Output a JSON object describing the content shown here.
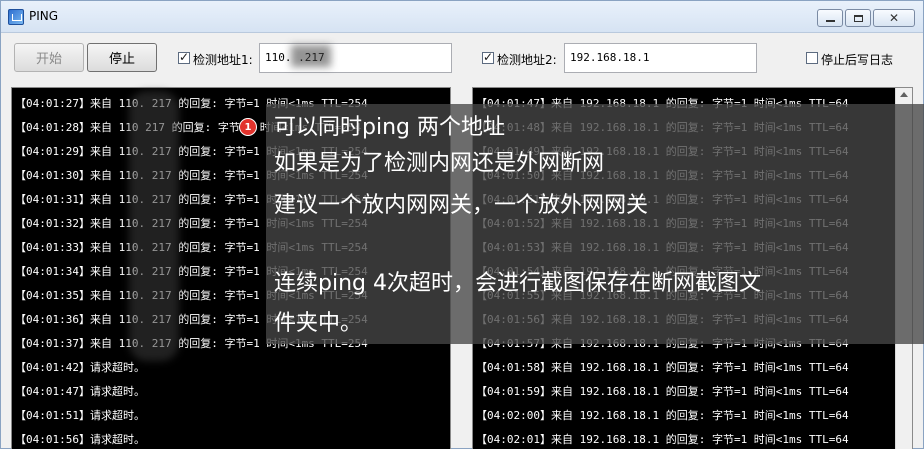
{
  "window": {
    "title": "PING"
  },
  "toolbar": {
    "start_label": "开始",
    "stop_label": "停止",
    "addr1_label": "检测地址1:",
    "addr1_value": "110.          .217",
    "addr2_label": "检测地址2:",
    "addr2_value": "192.168.18.1",
    "stoplog_label": "停止后写日志"
  },
  "left_log": [
    "【04:01:27】来自 110.          217 的回复: 字节=1 时间<1ms TTL=254",
    "【04:01:28】来自 110          217 的回复: 字节=1 时间<1ms TTL=254",
    "【04:01:29】来自 110.          217 的回复: 字节=1 时间<1ms TTL=254",
    "【04:01:30】来自 110.          217 的回复: 字节=1 时间<1ms TTL=254",
    "【04:01:31】来自 110.          217 的回复: 字节=1 时间<1ms TTL=254",
    "【04:01:32】来自 110.          217 的回复: 字节=1 时间<1ms TTL=254",
    "【04:01:33】来自 110.          217 的回复: 字节=1 时间<1ms TTL=254",
    "【04:01:34】来自 110.          217 的回复: 字节=1 时间<1ms TTL=254",
    "【04:01:35】来自 110.          217 的回复: 字节=1 时间<1ms TTL=254",
    "【04:01:36】来自 110.          217 的回复: 字节=1 时间<1ms TTL=254",
    "【04:01:37】来自 110.          217 的回复: 字节=1 时间<1ms TTL=254",
    "【04:01:42】请求超时。",
    "【04:01:47】请求超时。",
    "【04:01:51】请求超时。",
    "【04:01:56】请求超时。"
  ],
  "right_log": [
    "【04:01:47】来自 192.168.18.1 的回复: 字节=1 时间<1ms TTL=64",
    "【04:01:48】来自 192.168.18.1 的回复: 字节=1 时间<1ms TTL=64",
    "【04:01:49】来自 192.168.18.1 的回复: 字节=1 时间<1ms TTL=64",
    "【04:01:50】来自 192.168.18.1 的回复: 字节=1 时间<1ms TTL=64",
    "【04:01:51】来自 192.168.18.1 的回复: 字节=1 时间<1ms TTL=64",
    "【04:01:52】来自 192.168.18.1 的回复: 字节=1 时间<1ms TTL=64",
    "【04:01:53】来自 192.168.18.1 的回复: 字节=1 时间<1ms TTL=64",
    "【04:01:54】来自 192.168.18.1 的回复: 字节=1 时间<1ms TTL=64",
    "【04:01:55】来自 192.168.18.1 的回复: 字节=1 时间<1ms TTL=64",
    "【04:01:56】来自 192.168.18.1 的回复: 字节=1 时间<1ms TTL=64",
    "【04:01:57】来自 192.168.18.1 的回复: 字节=1 时间<1ms TTL=64",
    "【04:01:58】来自 192.168.18.1 的回复: 字节=1 时间<1ms TTL=64",
    "【04:01:59】来自 192.168.18.1 的回复: 字节=1 时间<1ms TTL=64",
    "【04:02:00】来自 192.168.18.1 的回复: 字节=1 时间<1ms TTL=64",
    "【04:02:01】来自 192.168.18.1 的回复: 字节=1 时间<1ms TTL=64"
  ],
  "annotation": {
    "badge": "1",
    "line1": "可以同时ping 两个地址",
    "line2": "如果是为了检测内网还是外网断网",
    "line3": "建议一个放内网网关，一个放外网网关",
    "line4": "连续ping 4次超时，会进行截图保存在断网截图文",
    "line5": "件夹中。"
  },
  "colors": {
    "log_bg": "#000000",
    "log_text": "#ffffff",
    "badge": "#e2332d"
  }
}
